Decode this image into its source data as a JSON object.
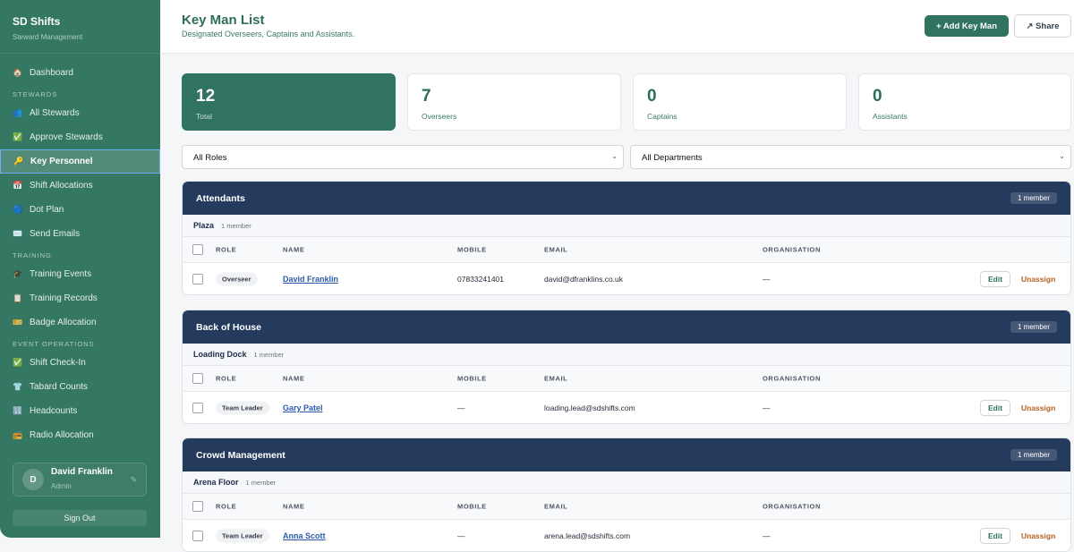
{
  "sidebar": {
    "title": "SD Shifts",
    "subtitle": "Steward Management",
    "items": [
      {
        "icon": "🏠",
        "label": "Dashboard",
        "name": "dashboard"
      },
      {
        "section": "STEWARDS"
      },
      {
        "icon": "👥",
        "label": "All Stewards",
        "name": "all-stewards"
      },
      {
        "icon": "✅",
        "label": "Approve Stewards",
        "name": "approve-stewards"
      },
      {
        "icon": "🔑",
        "label": "Key Personnel",
        "name": "key-personnel",
        "active": true
      },
      {
        "icon": "📅",
        "label": "Shift Allocations",
        "name": "shift-allocations"
      },
      {
        "icon": "🔵",
        "label": "Dot Plan",
        "name": "dot-plan"
      },
      {
        "icon": "✉️",
        "label": "Send Emails",
        "name": "send-emails"
      },
      {
        "section": "TRAINING"
      },
      {
        "icon": "🎓",
        "label": "Training Events",
        "name": "training-events"
      },
      {
        "icon": "📋",
        "label": "Training Records",
        "name": "training-records"
      },
      {
        "icon": "🎫",
        "label": "Badge Allocation",
        "name": "badge-allocation"
      },
      {
        "section": "EVENT OPERATIONS"
      },
      {
        "icon": "✅",
        "label": "Shift Check-In",
        "name": "shift-check-in"
      },
      {
        "icon": "👕",
        "label": "Tabard Counts",
        "name": "tabard-counts"
      },
      {
        "icon": "🔢",
        "label": "Headcounts",
        "name": "headcounts"
      },
      {
        "icon": "📻",
        "label": "Radio Allocation",
        "name": "radio-allocation"
      }
    ],
    "user": {
      "initial": "D",
      "name": "David Franklin",
      "role": "Admin"
    },
    "sign_out": "Sign Out"
  },
  "header": {
    "title": "Key Man List",
    "subtitle": "Designated Overseers, Captains and Assistants.",
    "add_label": "+ Add Key Man",
    "share_label": "↗ Share"
  },
  "stats": [
    {
      "value": "12",
      "label": "Total"
    },
    {
      "value": "7",
      "label": "Overseers"
    },
    {
      "value": "0",
      "label": "Captains"
    },
    {
      "value": "0",
      "label": "Assistants"
    }
  ],
  "filters": {
    "role": "All Roles",
    "department": "All Departments"
  },
  "columns": {
    "role": "ROLE",
    "name": "NAME",
    "mobile": "MOBILE",
    "email": "EMAIL",
    "org": "ORGANISATION"
  },
  "actions": {
    "edit": "Edit",
    "unassign": "Unassign"
  },
  "groups": [
    {
      "title": "Attendants",
      "count": "1 member",
      "sub": "Plaza",
      "sub_count": "1 member",
      "rows": [
        {
          "role": "Overseer",
          "name": "David Franklin",
          "mobile": "07833241401",
          "email": "david@dfranklins.co.uk",
          "org": "—"
        }
      ]
    },
    {
      "title": "Back of House",
      "count": "1 member",
      "sub": "Loading Dock",
      "sub_count": "1 member",
      "rows": [
        {
          "role": "Team Leader",
          "name": "Gary Patel",
          "mobile": "—",
          "email": "loading.lead@sdshifts.com",
          "org": "—"
        }
      ]
    },
    {
      "title": "Crowd Management",
      "count": "1 member",
      "sub": "Arena Floor",
      "sub_count": "1 member",
      "rows": [
        {
          "role": "Team Leader",
          "name": "Anna Scott",
          "mobile": "—",
          "email": "arena.lead@sdshifts.com",
          "org": "—"
        }
      ]
    }
  ]
}
